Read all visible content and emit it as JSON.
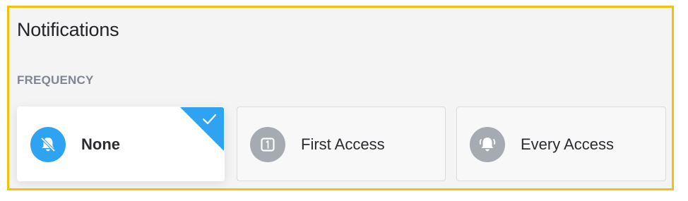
{
  "panel": {
    "title": "Notifications",
    "section_label": "FREQUENCY"
  },
  "frequency": {
    "selected": "None",
    "options": [
      {
        "label": "None",
        "icon": "bell-off-icon",
        "selected": true
      },
      {
        "label": "First Access",
        "icon": "number-one-icon",
        "selected": false
      },
      {
        "label": "Every Access",
        "icon": "bell-ringing-icon",
        "selected": false
      }
    ]
  },
  "colors": {
    "accent": "#2ea3f2",
    "highlight_border": "#f2c10b",
    "icon_inactive": "#a6aab1",
    "label_muted": "#7f8691"
  }
}
